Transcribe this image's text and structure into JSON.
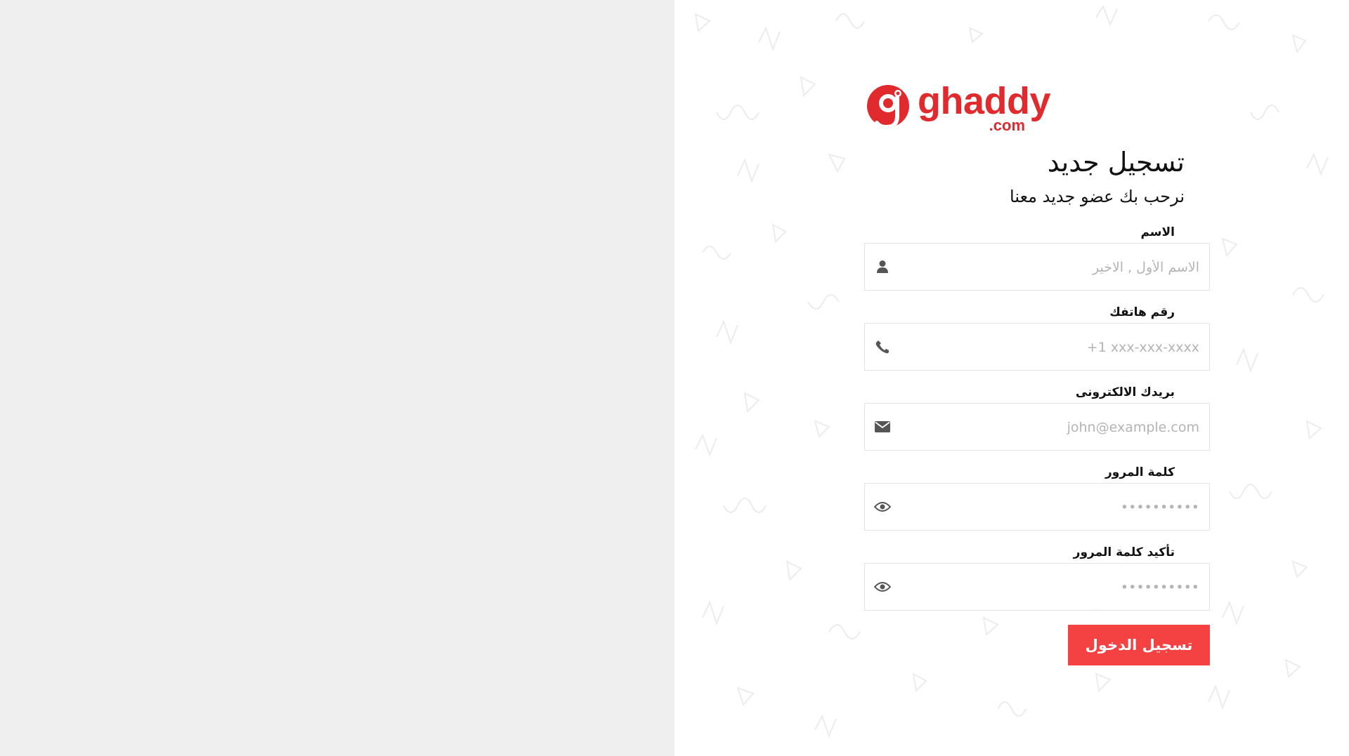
{
  "brand": {
    "logo_text": "ghaddy",
    "logo_suffix": ".com",
    "color": "#e02a2e"
  },
  "form": {
    "title": "تسجيل جديد",
    "subtitle": "نرحب بك عضو جديد معنا",
    "fields": [
      {
        "label": "الاسم",
        "placeholder": "الاسم الأول , الاخير",
        "icon": "user-icon",
        "type": "text"
      },
      {
        "label": "رقم هاتفك",
        "placeholder": "+1 xxx-xxx-xxxx",
        "icon": "phone-icon",
        "type": "tel"
      },
      {
        "label": "بريدك الالكترونى",
        "placeholder": "john@example.com",
        "icon": "envelope-icon",
        "type": "email"
      },
      {
        "label": "كلمة المرور",
        "placeholder": "••••••••••",
        "icon": "eye-icon",
        "type": "password"
      },
      {
        "label": "تأكيد كلمة المرور",
        "placeholder": "••••••••••",
        "icon": "eye-icon",
        "type": "password"
      }
    ],
    "submit_label": "تسجيل الدخول",
    "submit_color": "#f44242"
  },
  "colors": {
    "left_panel": "#efefef",
    "right_panel": "#ffffff"
  }
}
